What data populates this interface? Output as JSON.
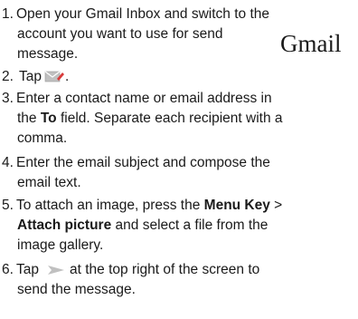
{
  "steps": [
    {
      "number": "1.",
      "lines": [
        "Open your Gmail Inbox and switch to the",
        "account you want to use for send",
        "message."
      ]
    },
    {
      "number": "2.",
      "text_before": "Tap",
      "icon": "compose-mail-icon",
      "text_after": "."
    },
    {
      "number": "3.",
      "line1": "Enter a contact name or email address in",
      "line2_before": "the ",
      "line2_bold": "To",
      "line2_after": " field. Separate each recipient with a",
      "line3": "comma."
    },
    {
      "number": "4.",
      "lines": [
        "Enter the email subject and compose the",
        "email text."
      ]
    },
    {
      "number": "5.",
      "line1_before": "To attach an image, press the ",
      "line1_bold": "Menu Key",
      "line1_after": " >",
      "line2_bold": "Attach picture",
      "line2_after": " and select a file from the",
      "line3": "image gallery."
    },
    {
      "number": "6.",
      "text_before": "Tap",
      "icon": "send-arrow-icon",
      "text_after": "at the top right of the screen to",
      "line2": "send the message."
    }
  ],
  "watermark": "Gmail",
  "colors": {
    "text": "#1a1a1a",
    "icon": "#c0c0c0"
  }
}
